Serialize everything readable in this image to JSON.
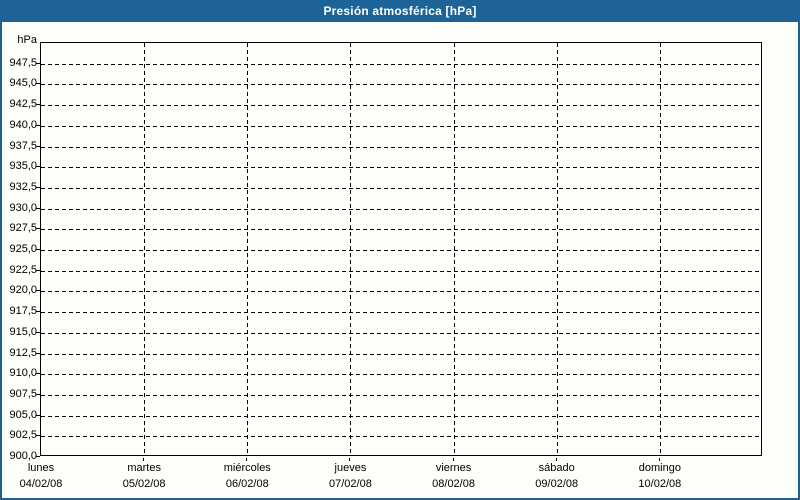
{
  "window": {
    "title": "Presión atmosférica [hPa]"
  },
  "colors": {
    "titlebar_bg": "#1d6397",
    "titlebar_text": "#ffffff",
    "frame_border": "#21618f",
    "background": "#fcfef9",
    "grid_and_text": "#000000"
  },
  "chart_data": {
    "type": "line",
    "title": "Presión atmosférica [hPa]",
    "ylabel": "hPa",
    "ylim": [
      900,
      950
    ],
    "ytick_step": 2.5,
    "grid": true,
    "series": [],
    "yticks": [
      {
        "value": 947.5,
        "label": "947,5"
      },
      {
        "value": 945.0,
        "label": "945,0"
      },
      {
        "value": 942.5,
        "label": "942,5"
      },
      {
        "value": 940.0,
        "label": "940,0"
      },
      {
        "value": 937.5,
        "label": "937,5"
      },
      {
        "value": 935.0,
        "label": "935,0"
      },
      {
        "value": 932.5,
        "label": "932,5"
      },
      {
        "value": 930.0,
        "label": "930,0"
      },
      {
        "value": 927.5,
        "label": "927,5"
      },
      {
        "value": 925.0,
        "label": "925,0"
      },
      {
        "value": 922.5,
        "label": "922,5"
      },
      {
        "value": 920.0,
        "label": "920,0"
      },
      {
        "value": 917.5,
        "label": "917,5"
      },
      {
        "value": 915.0,
        "label": "915,0"
      },
      {
        "value": 912.5,
        "label": "912,5"
      },
      {
        "value": 910.0,
        "label": "910,0"
      },
      {
        "value": 907.5,
        "label": "907,5"
      },
      {
        "value": 905.0,
        "label": "905,0"
      },
      {
        "value": 902.5,
        "label": "902,5"
      },
      {
        "value": 900.0,
        "label": "900,0"
      }
    ],
    "days": [
      {
        "name": "lunes",
        "date": "04/02/08"
      },
      {
        "name": "martes",
        "date": "05/02/08"
      },
      {
        "name": "miércoles",
        "date": "06/02/08"
      },
      {
        "name": "jueves",
        "date": "07/02/08"
      },
      {
        "name": "viernes",
        "date": "08/02/08"
      },
      {
        "name": "sábado",
        "date": "09/02/08"
      },
      {
        "name": "domingo",
        "date": "10/02/08"
      }
    ]
  }
}
